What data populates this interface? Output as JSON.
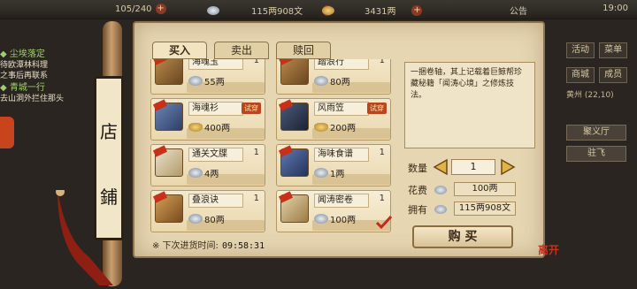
{
  "topbar": {
    "stamina": "105/240",
    "silver": "115两908文",
    "gold": "3431两",
    "notice": "公告",
    "clock": "19:00"
  },
  "quests": [
    {
      "title": "尘埃落定",
      "line1": "待欧潭林科理",
      "line2": "之事后再联系"
    },
    {
      "title": "青城一行",
      "line1": "去山洞外拦住那头",
      "line2": ""
    }
  ],
  "right_menu": {
    "btn1": "活动",
    "btn2": "菜单",
    "btn3": "商城",
    "btn4": "成员",
    "area": "黄州",
    "coord": "(22,10)",
    "wide1": "聚义厅",
    "wide2": "驻飞"
  },
  "shop": {
    "title_char1": "店",
    "title_char2": "鋪",
    "tabs": [
      "买入",
      "卖出",
      "赎回"
    ],
    "items": [
      {
        "name": "海魂玉",
        "qty": "1",
        "price": "55两",
        "currency": "silver",
        "try": ""
      },
      {
        "name": "踏浪行",
        "qty": "1",
        "price": "80两",
        "currency": "silver",
        "try": ""
      },
      {
        "name": "海魂衫",
        "qty": "",
        "price": "400两",
        "currency": "gold",
        "try": "试穿"
      },
      {
        "name": "风雨笠",
        "qty": "",
        "price": "200两",
        "currency": "gold",
        "try": "试穿"
      },
      {
        "name": "通关文牒",
        "qty": "1",
        "price": "4两",
        "currency": "silver",
        "try": ""
      },
      {
        "name": "海味食谱",
        "qty": "1",
        "price": "1两",
        "currency": "silver",
        "try": ""
      },
      {
        "name": "叠浪诀",
        "qty": "1",
        "price": "80两",
        "currency": "silver",
        "try": ""
      },
      {
        "name": "闻涛密卷",
        "qty": "1",
        "price": "100两",
        "currency": "silver",
        "try": ""
      }
    ],
    "restock_label": "※ 下次进货时间:",
    "restock_time": "09:58:31",
    "description": "一捆卷轴，其上记载着巨鲸帮珍藏秘籍「闻涛心境」之修炼技法。",
    "qty_label": "数量",
    "qty_value": "1",
    "cost_label": "花费",
    "cost_value": "100两",
    "own_label": "拥有",
    "own_value": "115两908文",
    "buy_label": "购 买",
    "seal_text": "离开"
  }
}
